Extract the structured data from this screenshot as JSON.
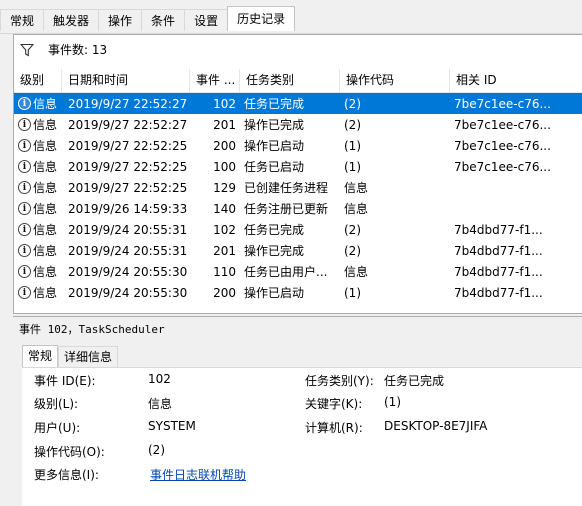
{
  "tabs": [
    "常规",
    "触发器",
    "操作",
    "条件",
    "设置",
    "历史记录"
  ],
  "filter": {
    "count_label": "事件数: 13"
  },
  "columns": [
    "级别",
    "日期和时间",
    "事件 ...",
    "任务类别",
    "操作代码",
    "相关 ID"
  ],
  "rows": [
    {
      "level": "信息",
      "date": "2019/9/27 22:52:27",
      "id": "102",
      "cat": "任务已完成",
      "op": "(2)",
      "rel": "7be7c1ee-c76..."
    },
    {
      "level": "信息",
      "date": "2019/9/27 22:52:27",
      "id": "201",
      "cat": "操作已完成",
      "op": "(2)",
      "rel": "7be7c1ee-c76..."
    },
    {
      "level": "信息",
      "date": "2019/9/27 22:52:25",
      "id": "200",
      "cat": "操作已启动",
      "op": "(1)",
      "rel": "7be7c1ee-c76..."
    },
    {
      "level": "信息",
      "date": "2019/9/27 22:52:25",
      "id": "100",
      "cat": "任务已启动",
      "op": "(1)",
      "rel": "7be7c1ee-c76..."
    },
    {
      "level": "信息",
      "date": "2019/9/27 22:52:25",
      "id": "129",
      "cat": "已创建任务进程",
      "op": "信息",
      "rel": ""
    },
    {
      "level": "信息",
      "date": "2019/9/26 14:59:33",
      "id": "140",
      "cat": "任务注册已更新",
      "op": "信息",
      "rel": ""
    },
    {
      "level": "信息",
      "date": "2019/9/24 20:55:31",
      "id": "102",
      "cat": "任务已完成",
      "op": "(2)",
      "rel": "7b4dbd77-f1..."
    },
    {
      "level": "信息",
      "date": "2019/9/24 20:55:31",
      "id": "201",
      "cat": "操作已完成",
      "op": "(2)",
      "rel": "7b4dbd77-f1..."
    },
    {
      "level": "信息",
      "date": "2019/9/24 20:55:30",
      "id": "110",
      "cat": "任务已由用户...",
      "op": "信息",
      "rel": "7b4dbd77-f1..."
    },
    {
      "level": "信息",
      "date": "2019/9/24 20:55:30",
      "id": "200",
      "cat": "操作已启动",
      "op": "(1)",
      "rel": "7b4dbd77-f1..."
    }
  ],
  "detail": {
    "title": "事件 102，TaskScheduler",
    "tabs": [
      "常规",
      "详细信息"
    ],
    "event_id_label": "事件 ID(E):",
    "event_id": "102",
    "task_category_label": "任务类别(Y):",
    "task_category": "任务已完成",
    "level_label": "级别(L):",
    "level": "信息",
    "keywords_label": "关键字(K):",
    "keywords": "(1)",
    "user_label": "用户(U):",
    "user": "SYSTEM",
    "computer_label": "计算机(R):",
    "computer": "DESKTOP-8E7JIFA",
    "opcode_label": "操作代码(O):",
    "opcode": "(2)",
    "more_info_label": "更多信息(I):",
    "more_info_link": "事件日志联机帮助"
  },
  "colors": {
    "selection": "#0078d7",
    "link": "#0645ad"
  },
  "selected_row": 0
}
